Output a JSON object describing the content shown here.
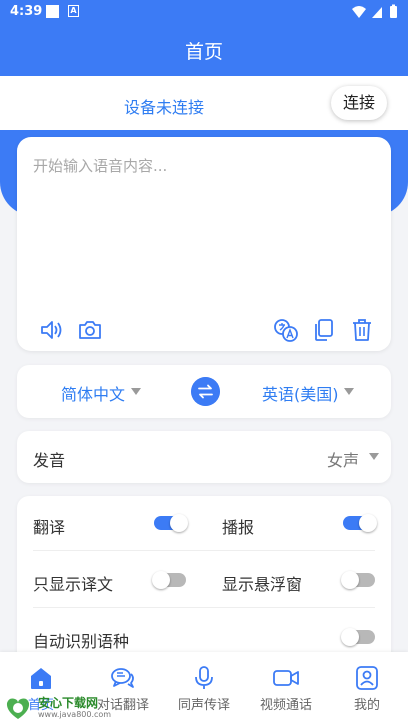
{
  "status_bar": {
    "time": "4:39",
    "badge": "A"
  },
  "app_bar": {
    "title": "首页"
  },
  "device": {
    "status": "设备未连接",
    "connect_label": "连接"
  },
  "input": {
    "placeholder": "开始输入语音内容..."
  },
  "tools": [
    "speaker-icon",
    "camera-icon",
    "language-detect-icon",
    "copy-icon",
    "trash-icon"
  ],
  "languages": {
    "source": "简体中文",
    "target": "英语(美国)",
    "swap_icon": "swap-icon"
  },
  "voice": {
    "label": "发音",
    "value": "女声"
  },
  "settings": [
    {
      "label": "翻译",
      "on": true
    },
    {
      "label": "播报",
      "on": true
    },
    {
      "label": "只显示译文",
      "on": false
    },
    {
      "label": "显示悬浮窗",
      "on": false
    },
    {
      "label": "自动识别语种",
      "on": false
    }
  ],
  "tabs": [
    {
      "label": "首页",
      "icon": "home-icon",
      "active": true
    },
    {
      "label": "对话翻译",
      "icon": "chat-icon",
      "active": false
    },
    {
      "label": "同声传译",
      "icon": "mic-icon",
      "active": false
    },
    {
      "label": "视频通话",
      "icon": "video-icon",
      "active": false
    },
    {
      "label": "我的",
      "icon": "profile-icon",
      "active": false
    }
  ],
  "watermark": {
    "title": "安心下载网",
    "url": "www.java800.com"
  },
  "colors": {
    "primary": "#3c7bf5",
    "link": "#2f7df2",
    "background": "#f3f4f7"
  }
}
